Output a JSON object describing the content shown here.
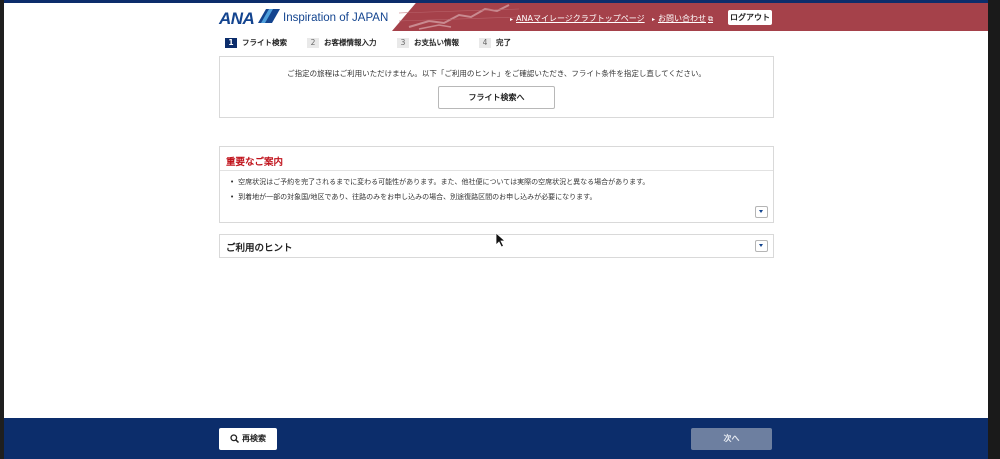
{
  "header": {
    "logo_text": "ANA",
    "tagline": "Inspiration of JAPAN",
    "links": [
      {
        "label": "ANAマイレージクラブトップページ"
      },
      {
        "label": "お問い合わせ"
      }
    ],
    "logout_label": "ログアウト"
  },
  "steps": [
    {
      "num": "1",
      "label": "フライト検索",
      "active": true
    },
    {
      "num": "2",
      "label": "お客様情報入力",
      "active": false
    },
    {
      "num": "3",
      "label": "お支払い情報",
      "active": false
    },
    {
      "num": "4",
      "label": "完了",
      "active": false
    }
  ],
  "notice": {
    "message": "ご指定の旅程はご利用いただけません。以下「ご利用のヒント」をご確認いただき、フライト条件を指定し直してください。",
    "button_label": "フライト検索へ"
  },
  "important": {
    "title": "重要なご案内",
    "items": [
      "空席状況はご予約を完了されるまでに変わる可能性があります。また、他社便については実際の空席状況と異なる場合があります。",
      "到着地が一部の対象国/地区であり、往路のみをお申し込みの場合、別途復路区間のお申し込みが必要になります。"
    ]
  },
  "hint": {
    "title": "ご利用のヒント"
  },
  "footer": {
    "research_label": "再検索",
    "next_label": "次へ"
  },
  "colors": {
    "brand_navy": "#0c2d6b",
    "header_red": "#a5414a",
    "alert_red": "#c0121b"
  }
}
